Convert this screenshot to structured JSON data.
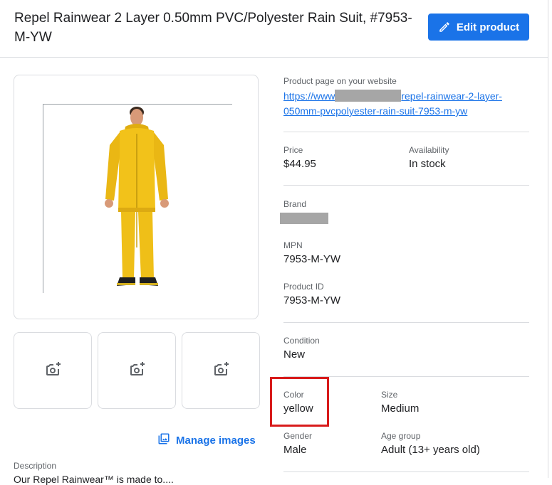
{
  "header": {
    "title": "Repel Rainwear 2 Layer 0.50mm PVC/Polyester Rain Suit, #7953-M-YW",
    "edit_button_label": "Edit product",
    "edit_icon": "pencil-icon"
  },
  "images": {
    "thumbnail_icon": "add-photo-icon",
    "manage_label": "Manage images",
    "manage_icon": "photo-library-icon"
  },
  "description": {
    "label": "Description",
    "text": "Our Repel Rainwear™ is made to...."
  },
  "details": {
    "product_page_label": "Product page on your website",
    "product_page_url_start": "https://www",
    "product_page_url_end": "repel-rainwear-2-layer-050mm-pvcpolyester-rain-suit-7953-m-yw",
    "price_label": "Price",
    "price_value": "$44.95",
    "availability_label": "Availability",
    "availability_value": "In stock",
    "brand_label": "Brand",
    "mpn_label": "MPN",
    "mpn_value": "7953-M-YW",
    "product_id_label": "Product ID",
    "product_id_value": "7953-M-YW",
    "condition_label": "Condition",
    "condition_value": "New",
    "color_label": "Color",
    "color_value": "yellow",
    "size_label": "Size",
    "size_value": "Medium",
    "gender_label": "Gender",
    "gender_value": "Male",
    "age_group_label": "Age group",
    "age_group_value": "Adult (13+ years old)"
  },
  "colors": {
    "accent": "#1a73e8",
    "highlight": "#d81b1b",
    "suit": "#f2c21a"
  }
}
